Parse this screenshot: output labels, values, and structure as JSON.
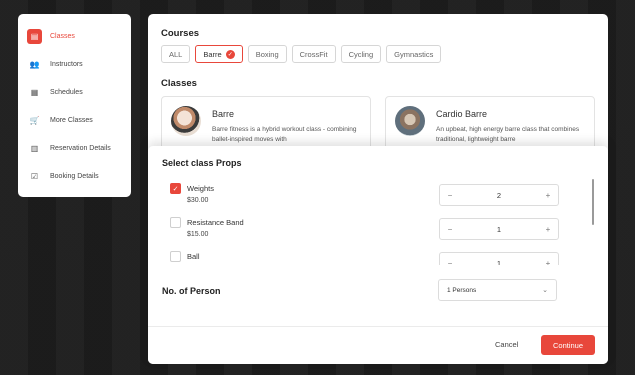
{
  "sidebar": {
    "items": [
      {
        "label": "Classes",
        "icon": "classes-icon",
        "glyph": "▤"
      },
      {
        "label": "Instructors",
        "icon": "people-icon",
        "glyph": "👥"
      },
      {
        "label": "Schedules",
        "icon": "calendar-icon",
        "glyph": "▦"
      },
      {
        "label": "More Classes",
        "icon": "cart-icon",
        "glyph": "🛒"
      },
      {
        "label": "Reservation Details",
        "icon": "document-icon",
        "glyph": "▥"
      },
      {
        "label": "Booking Details",
        "icon": "checklist-icon",
        "glyph": "☑"
      }
    ],
    "active_index": 0
  },
  "courses": {
    "title": "Courses",
    "chips": [
      "ALL",
      "Barre",
      "Boxing",
      "CrossFit",
      "Cycling",
      "Gymnastics"
    ],
    "selected": "Barre"
  },
  "classes": {
    "title": "Classes",
    "cards": [
      {
        "name": "Barre",
        "desc": "Barre fitness is a hybrid workout class - combining ballet-inspired moves with"
      },
      {
        "name": "Cardio Barre",
        "desc": "An upbeat, high energy barre class that combines traditional, lightweight barre"
      }
    ]
  },
  "modal": {
    "title": "Select class Props",
    "props": [
      {
        "name": "Weights",
        "price": "$30.00",
        "checked": true,
        "qty": "2"
      },
      {
        "name": "Resistance Band",
        "price": "$15.00",
        "checked": false,
        "qty": "1"
      },
      {
        "name": "Ball",
        "price": "",
        "checked": false,
        "qty": "1"
      }
    ],
    "persons_label": "No. of Person",
    "persons_value": "1 Persons",
    "cancel_label": "Cancel",
    "continue_label": "Continue"
  },
  "colors": {
    "accent": "#e8473b"
  }
}
